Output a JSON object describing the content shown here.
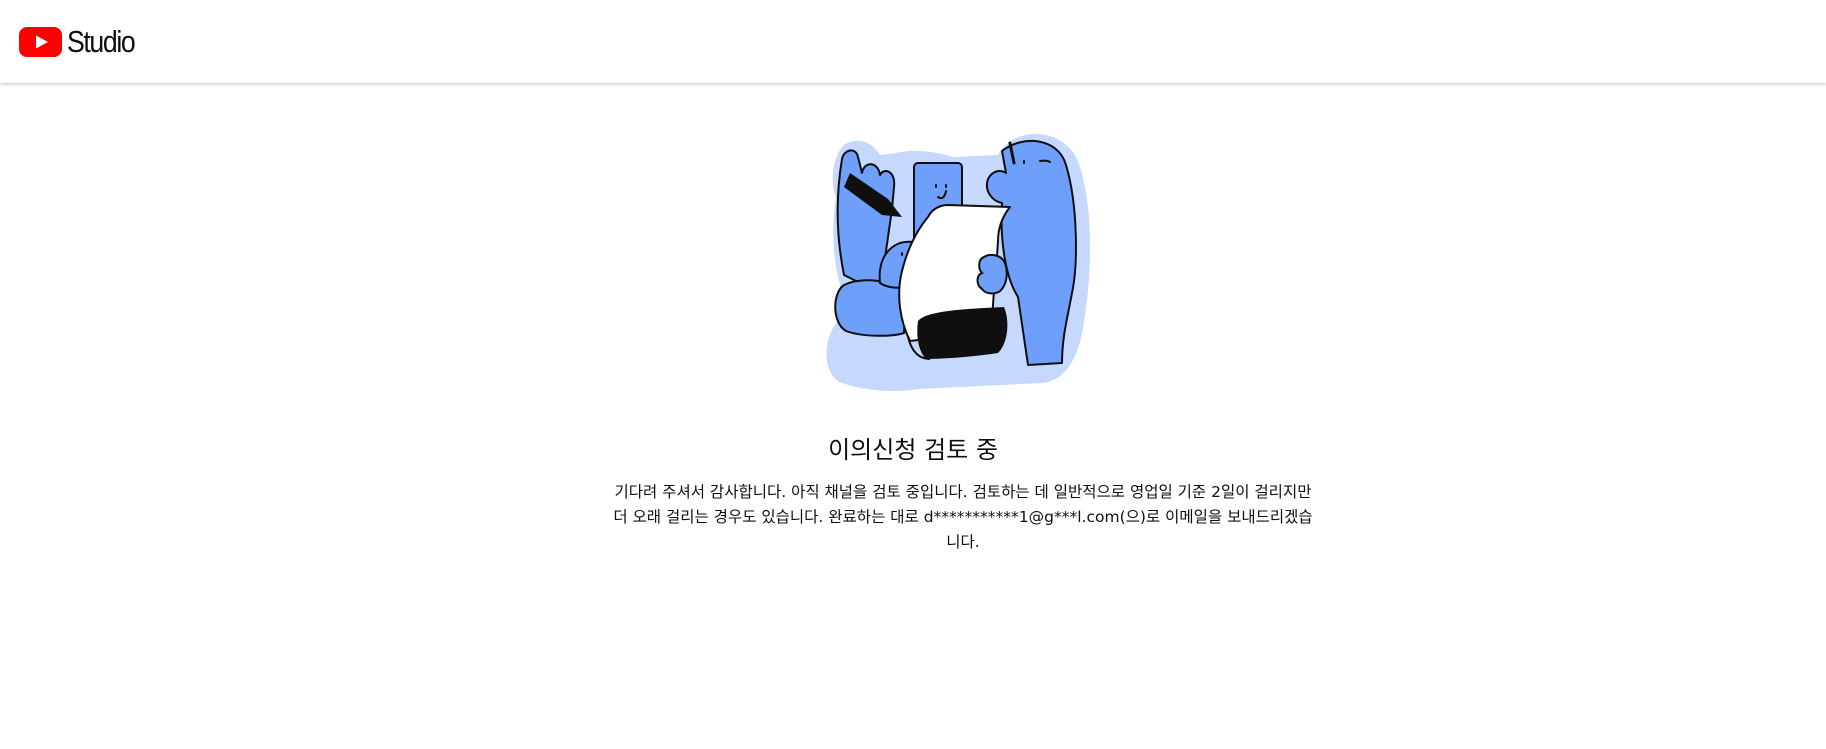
{
  "header": {
    "logo_text": "Studio",
    "logo_icon": "youtube-play-icon",
    "brand_color": "#ff0000"
  },
  "status": {
    "illustration": "appeal-review-illustration",
    "title": "이의신청 검토 중",
    "message": "기다려 주셔서 감사합니다. 아직 채널을 검토 중입니다. 검토하는 데 일반적으로 영업일 기준 2일이 걸리지만 더 오래 걸리는 경우도 있습니다. 완료하는 대로 d***********1@g***l.com(으)로 이메일을 보내드리겠습니다."
  },
  "colors": {
    "figure_blue": "#6d9ffb",
    "halo_blue": "#c6d8fd",
    "ink": "#0f0f0f"
  }
}
